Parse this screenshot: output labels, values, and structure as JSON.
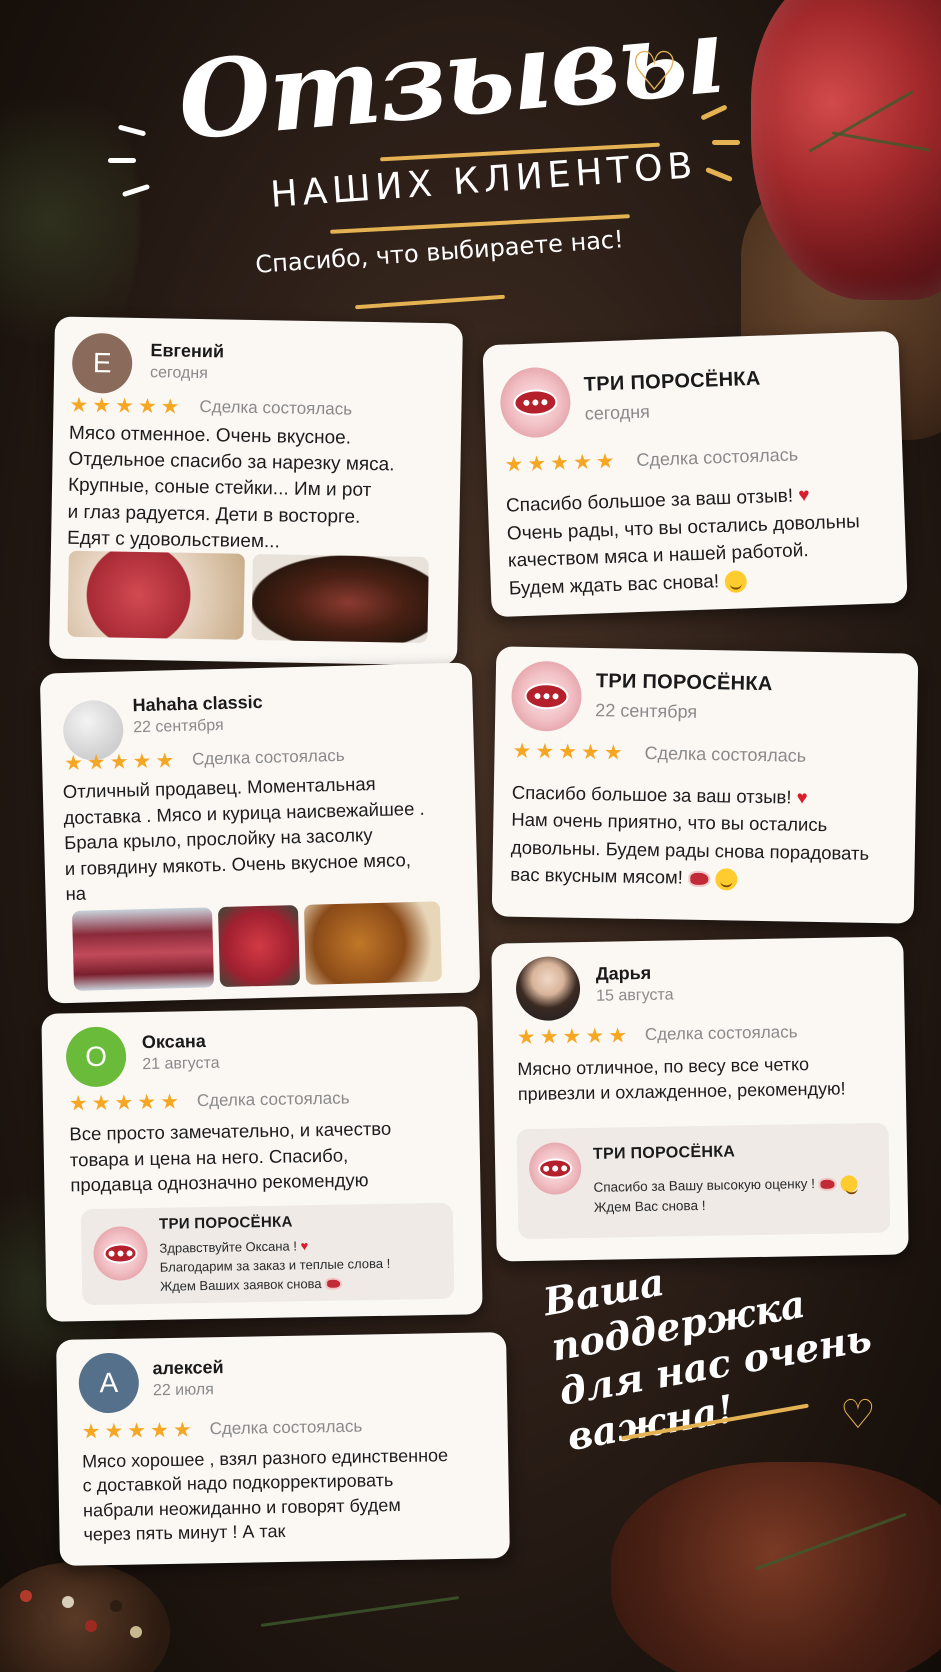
{
  "header": {
    "title": "Отзывы",
    "subtitle": "НАШИХ КЛИЕНТОВ",
    "thanks": "Спасибо, что выбираете нас!"
  },
  "deal_label": "Сделка состоялась",
  "seller_name": "ТРИ ПОРОСЁНКА",
  "reviews": [
    {
      "initial": "Е",
      "name": "Евгений",
      "date": "сегодня",
      "rating": 5,
      "avatar_color": "#8a6a5a",
      "lines": [
        "Мясо отменное. Очень вкусное.",
        "Отдельное спасибо за нарезку мяса.",
        "Крупные, соные стейки... Им и рот",
        "и глаз радуется. Дети в восторге.",
        "Едят с удовольствием..."
      ]
    },
    {
      "initial": "",
      "name": "Hahaha classic",
      "date": "22 сентября",
      "rating": 5,
      "avatar_color": "#cfcfcf",
      "lines": [
        "Отличный продавец. Моментальная",
        "доставка . Мясо и курица наисвежайшее .",
        "Брала крыло, прослойку на засолку",
        "и говядину мякоть. Очень вкусное мясо,",
        "на"
      ]
    },
    {
      "initial": "О",
      "name": "Оксана",
      "date": "21 августа",
      "rating": 5,
      "avatar_color": "#6bbb3a",
      "lines": [
        "Все просто замечательно, и качество",
        "товара и цена на него. Спасибо,",
        "продавца однозначно рекомендую"
      ],
      "reply": [
        "Здравствуйте Оксана !",
        "Благодарим за заказ и теплые слова !",
        "Ждем Ваших заявок снова"
      ]
    },
    {
      "initial": "А",
      "name": "алексей",
      "date": "22 июля",
      "rating": 5,
      "avatar_color": "#55708a",
      "lines": [
        "Мясо хорошее , взял разного единственное",
        "с доставкой надо подкорректировать",
        "набрали неожиданно и говорят будем",
        "через пять минут ! А так"
      ]
    }
  ],
  "seller_replies": [
    {
      "date": "сегодня",
      "lines": [
        "Спасибо большое за ваш отзыв!",
        "Очень рады, что вы остались довольны",
        "качеством мяса и нашей работой.",
        "Будем ждать вас снова!"
      ]
    },
    {
      "date": "22 сентября",
      "lines": [
        "Спасибо большое за ваш отзыв!",
        "Нам очень приятно, что вы остались",
        "довольны. Будем рады снова порадовать",
        "вас вкусным мясом!"
      ]
    }
  ],
  "darya": {
    "name": "Дарья",
    "date": "15 августа",
    "rating": 5,
    "lines": [
      "Мясно отличное, по весу все четко",
      "привезли и охлажденное, рекомендую!"
    ],
    "reply": [
      "Спасибо за Вашу высокую оценку !",
      "Ждем Вас снова !"
    ]
  },
  "support": {
    "line1": "Ваша поддержка",
    "line2": "для нас очень важна!"
  },
  "colors": {
    "star": "#f5a623",
    "gold": "#e4b253",
    "heart_red": "#d81e2c"
  }
}
